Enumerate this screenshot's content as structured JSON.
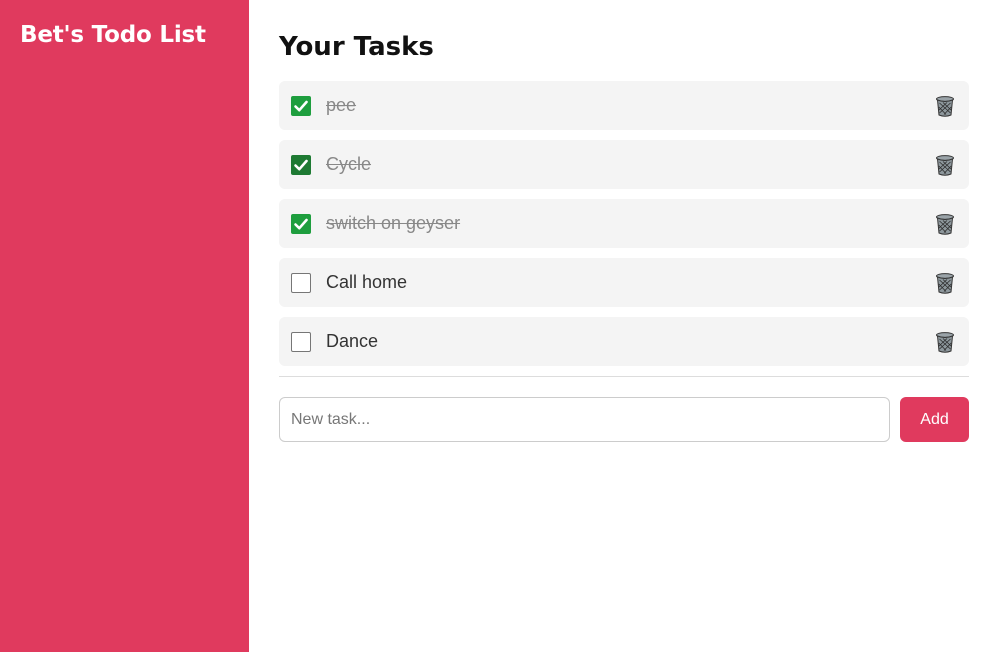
{
  "sidebar": {
    "title": "Bet's Todo List"
  },
  "main": {
    "title": "Your Tasks",
    "tasks": [
      {
        "label": "pee",
        "done": true,
        "delete_icon": "trash-icon"
      },
      {
        "label": "Cycle",
        "done": true,
        "delete_icon": "trash-icon"
      },
      {
        "label": "switch on geyser",
        "done": true,
        "delete_icon": "trash-icon"
      },
      {
        "label": "Call home",
        "done": false,
        "delete_icon": "trash-icon"
      },
      {
        "label": "Dance",
        "done": false,
        "delete_icon": "trash-icon"
      }
    ],
    "new_task": {
      "placeholder": "New task...",
      "value": ""
    },
    "add_button_label": "Add"
  },
  "colors": {
    "accent": "#e03a5e",
    "check_green": "#1e9e3e",
    "row_background": "#f4f4f4"
  }
}
